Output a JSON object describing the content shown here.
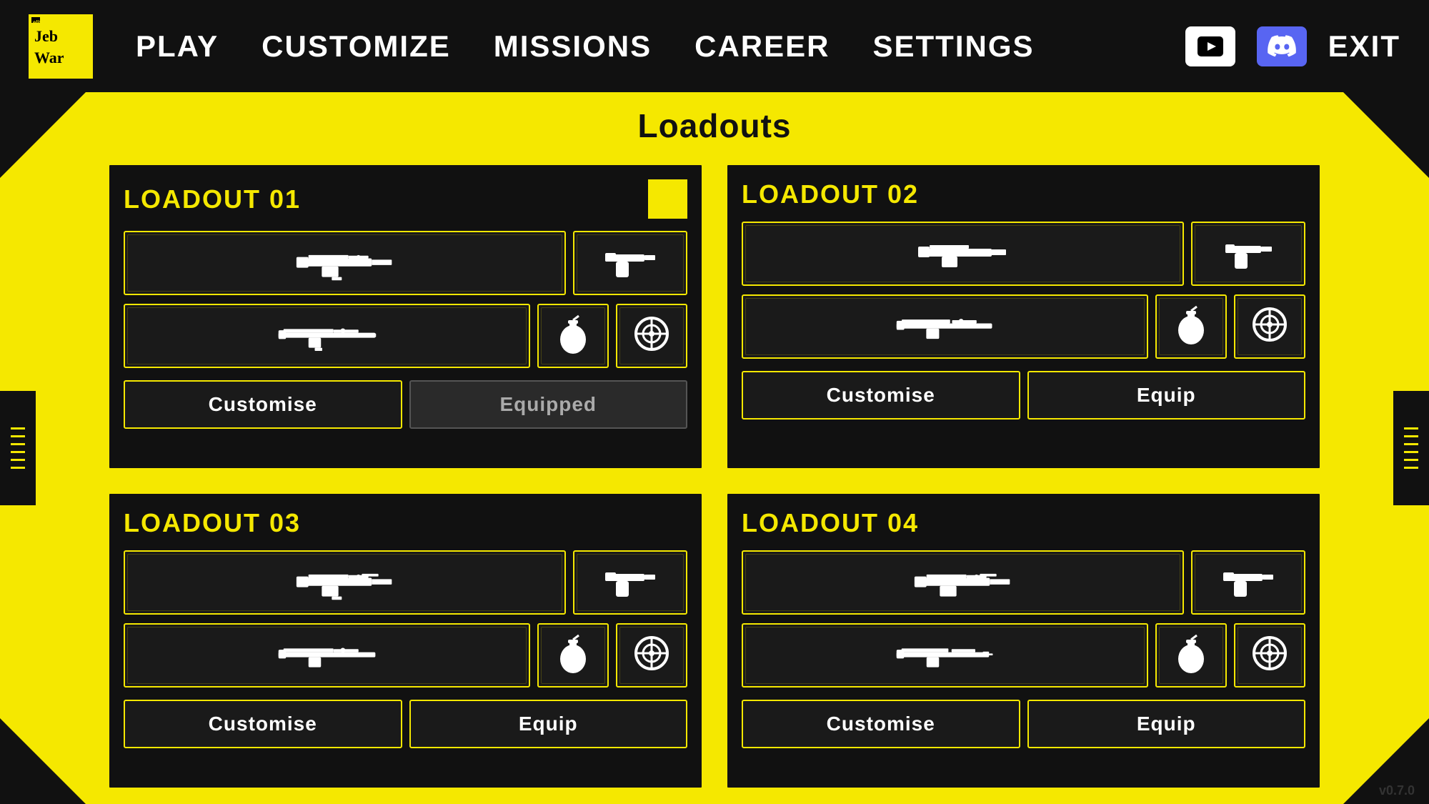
{
  "navbar": {
    "logo_text": "Jeb\nWar",
    "links": [
      {
        "id": "play",
        "label": "PLAY"
      },
      {
        "id": "customize",
        "label": "CUSTOMIZE"
      },
      {
        "id": "missions",
        "label": "MISSIONS"
      },
      {
        "id": "career",
        "label": "CAREER"
      },
      {
        "id": "settings",
        "label": "SETTINGS"
      }
    ],
    "youtube_label": "▶",
    "exit_label": "EXIT"
  },
  "page": {
    "title": "Loadouts"
  },
  "loadouts": [
    {
      "id": "loadout-01",
      "title": "LOADOUT 01",
      "equipped": true,
      "customise_label": "Customise",
      "equip_label": "Equipped"
    },
    {
      "id": "loadout-02",
      "title": "LOADOUT 02",
      "equipped": false,
      "customise_label": "Customise",
      "equip_label": "Equip"
    },
    {
      "id": "loadout-03",
      "title": "LOADOUT 03",
      "equipped": false,
      "customise_label": "Customise",
      "equip_label": "Equip"
    },
    {
      "id": "loadout-04",
      "title": "LOADOUT 04",
      "equipped": false,
      "customise_label": "Customise",
      "equip_label": "Equip"
    }
  ],
  "version": "v0.7.0"
}
